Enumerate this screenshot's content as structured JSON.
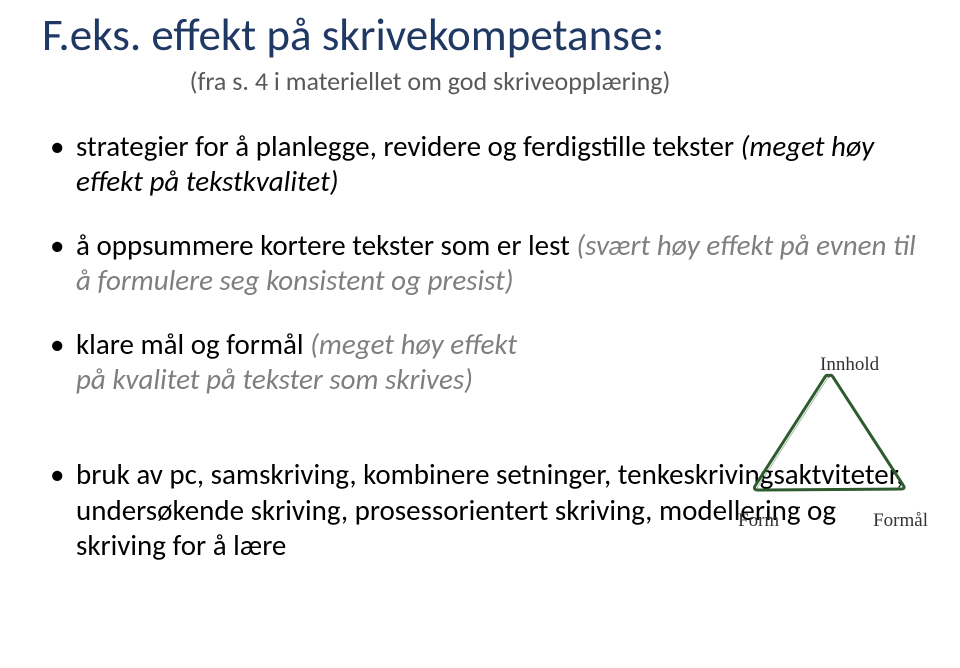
{
  "title": "F.eks. effekt på skrivekompetanse:",
  "subtitle": "(fra s. 4 i materiellet om god skriveopplæring)",
  "bullets": {
    "b1_main": "strategier for å planlegge, revidere og ferdigstille tekster ",
    "b1_paren": "(meget høy effekt på tekstkvalitet)",
    "b2_main": "å oppsummere kortere tekster som er lest ",
    "b2_paren": "(svært høy effekt på evnen til å formulere seg konsistent og presist)",
    "b3_main": "klare mål og formål ",
    "b3_paren_a": "(meget høy effekt",
    "b3_paren_b": "på kvalitet på tekster som skrives)",
    "b4_main": "bruk av pc, samskriving, kombinere setninger, tenkeskrivingsaktviteter, undersøkende skriving, prosessorientert skriving, modellering og skriving for å lære"
  },
  "triangle": {
    "top": "Innhold",
    "left": "Form",
    "right": "Formål"
  }
}
